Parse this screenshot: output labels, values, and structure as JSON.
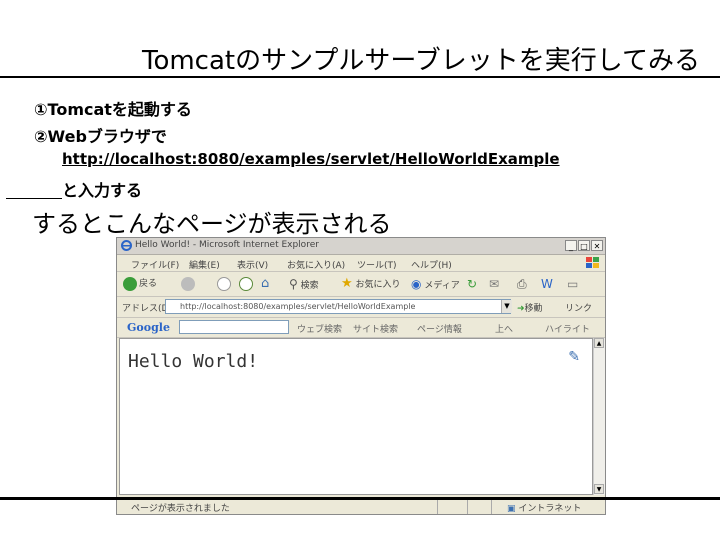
{
  "slide": {
    "title": "Tomcatのサンプルサーブレットを実行してみる",
    "step1": "①Tomcatを起動する",
    "step2": "②Webブラウザで",
    "url": "http://localhost:8080/examples/servlet/HelloWorldExample",
    "step3": "と入力する",
    "result": "するとこんなページが表示される"
  },
  "browser": {
    "title": "Hello World! - Microsoft Internet Explorer",
    "window_buttons": {
      "minimize": "_",
      "maximize": "□",
      "close": "✕"
    },
    "menu": [
      "ファイル(F)",
      "編集(E)",
      "表示(V)",
      "お気に入り(A)",
      "ツール(T)",
      "ヘルプ(H)"
    ],
    "toolbar": {
      "back": "戻る",
      "forward": "",
      "search": "検索",
      "favorites": "お気に入り",
      "media": "メディア"
    },
    "address": {
      "label": "アドレス(D)",
      "value": "http://localhost:8080/examples/servlet/HelloWorldExample",
      "go": "移動",
      "links": "リンク"
    },
    "google_bar": {
      "logo": "Google",
      "web_search": "ウェブ検索",
      "site_search": "サイト検索",
      "page_info": "ページ情報",
      "up": "上へ",
      "highlight": "ハイライト"
    },
    "page": {
      "heading": "Hello World!"
    },
    "status": {
      "left": "ページが表示されました",
      "zone": "イントラネット"
    }
  },
  "colors": {
    "ie_blue": "#2a64c8",
    "go_green": "#3a9d3a",
    "window_bg": "#ece9d8"
  },
  "icons": [
    "ie-icon",
    "windows-flag-icon",
    "back-icon",
    "forward-icon",
    "stop-icon",
    "refresh-icon",
    "home-icon",
    "search-icon",
    "favorites-icon",
    "media-icon",
    "history-icon",
    "mail-icon",
    "print-icon",
    "edit-icon",
    "page-icon",
    "go-icon",
    "edit-page-icon",
    "tools-icon",
    "intranet-icon"
  ]
}
